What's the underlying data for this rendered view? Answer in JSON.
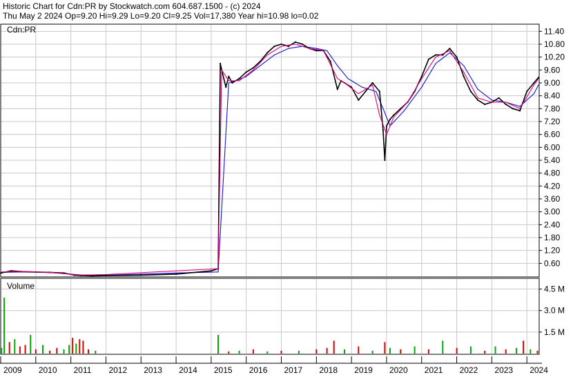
{
  "header": {
    "title_line": "Historic Chart for Cdn:PR by Stockwatch.com 604.687.1500 - (c) 2024",
    "stats_line": "Thu May  2 2024  Op=9.20  Hi=9.29  Lo=9.20  Cl=9.25  Vol=17,380  Year hi=10.98  lo=0.02"
  },
  "colors": {
    "price": "#000000",
    "ma_short": "#e0007a",
    "ma_long": "#1010d0",
    "volume_up": "#00aa00",
    "volume_down": "#dd0000",
    "grid": "#c8c8c8"
  },
  "chart_data": [
    {
      "type": "line",
      "title": "Cdn:PR",
      "ylim": [
        0,
        11.7
      ],
      "y_ticks": [
        "11.40",
        "10.80",
        "10.20",
        "9.60",
        "9.00",
        "8.40",
        "7.80",
        "7.20",
        "6.60",
        "6.00",
        "5.40",
        "4.80",
        "4.20",
        "3.60",
        "3.00",
        "2.40",
        "1.80",
        "1.20",
        "0.60"
      ],
      "y_tick_values": [
        11.4,
        10.8,
        10.2,
        9.6,
        9.0,
        8.4,
        7.8,
        7.2,
        6.6,
        6.0,
        5.4,
        4.8,
        4.2,
        3.6,
        3.0,
        2.4,
        1.8,
        1.2,
        0.6
      ],
      "x_ticks": [
        "2009",
        "2010",
        "2011",
        "2012",
        "2013",
        "2014",
        "2015",
        "2016",
        "2017",
        "2018",
        "2019",
        "2020",
        "2021",
        "2022",
        "2023",
        "2024"
      ],
      "x_tick_values": [
        2009,
        2010,
        2011,
        2012,
        2013,
        2014,
        2015,
        2016,
        2017,
        2018,
        2019,
        2020,
        2021,
        2022,
        2023,
        2024
      ],
      "xlim": [
        2009.0,
        2024.35
      ],
      "series": [
        {
          "key": "price",
          "x": [
            2009.0,
            2009.3,
            2009.6,
            2010.0,
            2010.4,
            2010.8,
            2011.1,
            2011.3,
            2011.6,
            2012.0,
            2013.0,
            2014.0,
            2015.0,
            2015.2,
            2015.26,
            2015.3,
            2015.36,
            2015.42,
            2015.5,
            2015.6,
            2015.8,
            2016.0,
            2016.2,
            2016.4,
            2016.6,
            2016.8,
            2017.0,
            2017.2,
            2017.4,
            2017.6,
            2017.8,
            2018.0,
            2018.2,
            2018.4,
            2018.6,
            2018.7,
            2018.8,
            2019.0,
            2019.2,
            2019.4,
            2019.6,
            2019.8,
            2019.9,
            2019.95,
            2020.0,
            2020.1,
            2020.2,
            2020.4,
            2020.6,
            2020.8,
            2021.0,
            2021.2,
            2021.4,
            2021.6,
            2021.8,
            2022.0,
            2022.2,
            2022.4,
            2022.6,
            2022.8,
            2023.0,
            2023.2,
            2023.4,
            2023.6,
            2023.8,
            2024.0,
            2024.2,
            2024.33
          ],
          "y": [
            0.15,
            0.25,
            0.22,
            0.2,
            0.18,
            0.15,
            0.05,
            0.03,
            0.02,
            0.03,
            0.05,
            0.1,
            0.25,
            0.35,
            9.9,
            9.6,
            9.2,
            8.8,
            9.3,
            9.0,
            9.2,
            9.5,
            9.7,
            10.0,
            10.4,
            10.7,
            10.8,
            10.7,
            10.9,
            10.8,
            10.6,
            10.5,
            10.5,
            10.0,
            8.7,
            9.1,
            9.0,
            8.8,
            8.2,
            8.6,
            9.0,
            8.6,
            6.8,
            5.4,
            7.0,
            7.3,
            7.5,
            7.8,
            8.1,
            8.6,
            9.3,
            10.1,
            10.3,
            10.3,
            10.6,
            10.2,
            9.3,
            8.6,
            8.2,
            8.0,
            8.1,
            8.3,
            8.0,
            7.8,
            7.7,
            8.6,
            9.0,
            9.25
          ]
        },
        {
          "key": "ma_short",
          "x": [
            2009.0,
            2009.6,
            2010.4,
            2011.3,
            2012.0,
            2014.0,
            2015.2,
            2015.3,
            2015.5,
            2015.8,
            2016.2,
            2016.6,
            2017.0,
            2017.4,
            2017.8,
            2018.2,
            2018.6,
            2018.8,
            2019.2,
            2019.6,
            2019.8,
            2020.0,
            2020.2,
            2020.6,
            2021.0,
            2021.4,
            2021.8,
            2022.2,
            2022.6,
            2023.0,
            2023.4,
            2023.8,
            2024.2,
            2024.33
          ],
          "y": [
            0.2,
            0.22,
            0.18,
            0.05,
            0.08,
            0.25,
            0.35,
            9.6,
            9.1,
            9.1,
            9.6,
            10.3,
            10.7,
            10.8,
            10.6,
            10.5,
            9.2,
            9.0,
            8.5,
            8.9,
            7.5,
            6.6,
            7.4,
            8.1,
            9.2,
            10.2,
            10.5,
            9.5,
            8.3,
            8.1,
            8.1,
            7.8,
            8.9,
            9.2
          ]
        },
        {
          "key": "ma_long",
          "x": [
            2009.0,
            2009.6,
            2010.4,
            2011.3,
            2012.0,
            2014.0,
            2015.2,
            2015.5,
            2015.7,
            2016.0,
            2016.4,
            2016.8,
            2017.2,
            2017.6,
            2018.0,
            2018.3,
            2018.6,
            2018.9,
            2019.3,
            2019.7,
            2019.9,
            2020.1,
            2020.5,
            2021.0,
            2021.4,
            2021.8,
            2022.2,
            2022.6,
            2023.0,
            2023.4,
            2023.8,
            2024.2,
            2024.33
          ],
          "y": [
            0.18,
            0.2,
            0.17,
            0.06,
            0.05,
            0.15,
            0.2,
            9.0,
            9.1,
            9.3,
            9.8,
            10.3,
            10.6,
            10.7,
            10.6,
            10.5,
            9.8,
            9.2,
            8.8,
            8.6,
            7.8,
            7.0,
            7.7,
            8.8,
            9.9,
            10.4,
            9.8,
            8.7,
            8.2,
            8.1,
            7.9,
            8.5,
            8.9
          ]
        }
      ]
    },
    {
      "type": "bar",
      "title": "Volume",
      "ylim": [
        0,
        5.2
      ],
      "y_ticks": [
        "4.5 M",
        "3.0 M",
        "1.5 M"
      ],
      "y_tick_values": [
        4.5,
        3.0,
        1.5
      ],
      "unit": "M",
      "x": [
        2009.02,
        2009.1,
        2009.25,
        2009.4,
        2009.55,
        2009.7,
        2009.85,
        2010.0,
        2010.2,
        2010.4,
        2010.6,
        2010.8,
        2010.95,
        2011.05,
        2011.15,
        2011.25,
        2011.35,
        2011.5,
        2011.7,
        2015.2,
        2015.5,
        2015.8,
        2016.2,
        2016.6,
        2017.0,
        2017.5,
        2018.0,
        2018.3,
        2018.5,
        2018.8,
        2019.2,
        2019.6,
        2019.95,
        2020.1,
        2020.4,
        2020.8,
        2021.2,
        2021.6,
        2022.0,
        2022.4,
        2022.8,
        2023.1,
        2023.4,
        2023.7,
        2023.9,
        2024.1,
        2024.3
      ],
      "values": [
        0.4,
        3.9,
        0.8,
        1.0,
        0.5,
        0.6,
        1.3,
        0.3,
        0.6,
        0.2,
        0.4,
        0.3,
        0.6,
        1.1,
        0.7,
        1.0,
        0.9,
        0.3,
        0.2,
        1.3,
        0.15,
        0.2,
        0.3,
        0.15,
        0.2,
        0.2,
        0.3,
        0.4,
        0.9,
        0.3,
        0.5,
        0.2,
        0.8,
        0.4,
        0.3,
        0.5,
        0.3,
        0.9,
        0.4,
        0.5,
        0.2,
        0.5,
        0.3,
        0.4,
        0.9,
        0.3,
        0.2
      ],
      "up": [
        true,
        true,
        false,
        true,
        false,
        false,
        true,
        false,
        true,
        false,
        false,
        true,
        true,
        false,
        true,
        false,
        false,
        false,
        true,
        true,
        false,
        true,
        false,
        true,
        false,
        true,
        false,
        false,
        false,
        true,
        false,
        true,
        false,
        true,
        false,
        true,
        false,
        true,
        false,
        true,
        false,
        true,
        false,
        true,
        false,
        true,
        false
      ]
    }
  ]
}
